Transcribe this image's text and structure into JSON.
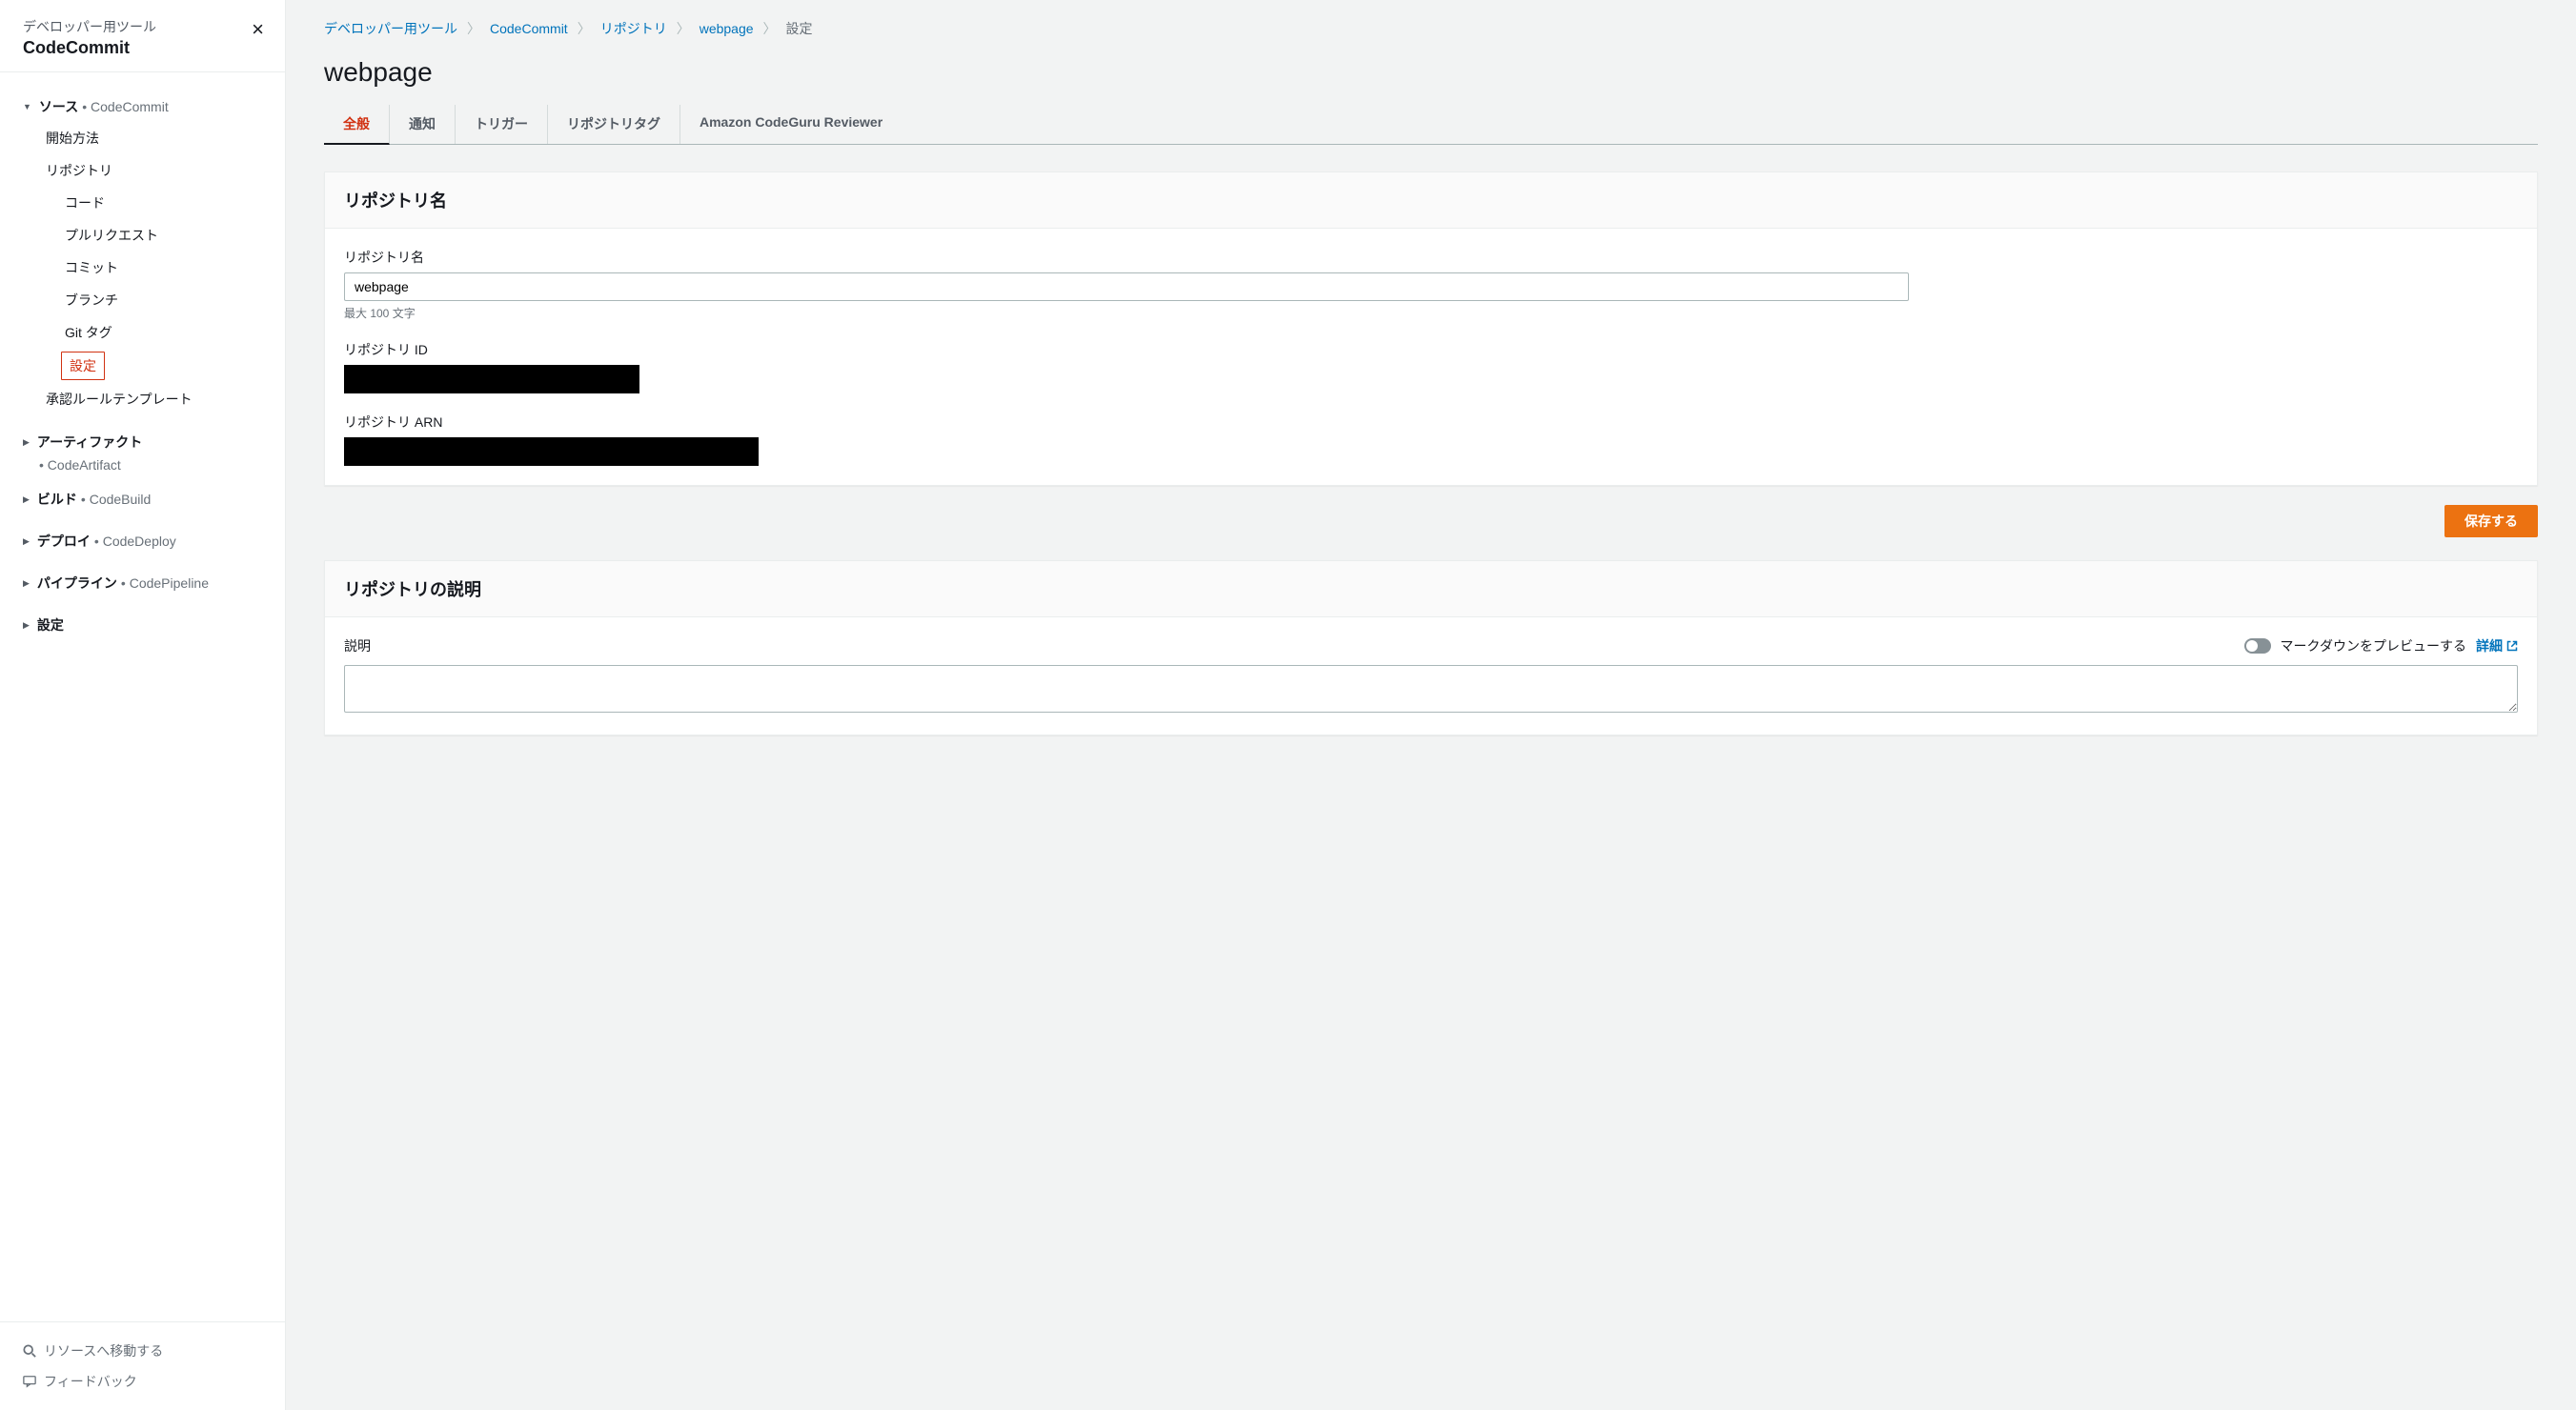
{
  "sidebar": {
    "subtitle": "デベロッパー用ツール",
    "title": "CodeCommit",
    "groups": [
      {
        "label": "ソース",
        "suffix": "• CodeCommit",
        "open": true,
        "items": [
          {
            "label": "開始方法"
          },
          {
            "label": "リポジトリ",
            "sub": [
              {
                "label": "コード"
              },
              {
                "label": "プルリクエスト"
              },
              {
                "label": "コミット"
              },
              {
                "label": "ブランチ"
              },
              {
                "label": "Git タグ"
              },
              {
                "label": "設定",
                "active": true
              }
            ]
          },
          {
            "label": "承認ルールテンプレート"
          }
        ]
      },
      {
        "label": "アーティファクト",
        "suffix_below": "• CodeArtifact",
        "open": false
      },
      {
        "label": "ビルド",
        "suffix": "• CodeBuild",
        "open": false
      },
      {
        "label": "デプロイ",
        "suffix": "• CodeDeploy",
        "open": false
      },
      {
        "label": "パイプライン",
        "suffix": "• CodePipeline",
        "open": false
      },
      {
        "label": "設定",
        "open": false
      }
    ],
    "footer": {
      "search": "リソースへ移動する",
      "feedback": "フィードバック"
    }
  },
  "breadcrumb": {
    "items": [
      "デベロッパー用ツール",
      "CodeCommit",
      "リポジトリ",
      "webpage"
    ],
    "current": "設定"
  },
  "page": {
    "title": "webpage"
  },
  "tabs": [
    "全般",
    "通知",
    "トリガー",
    "リポジトリタグ",
    "Amazon CodeGuru Reviewer"
  ],
  "panel1": {
    "title": "リポジトリ名",
    "name_label": "リポジトリ名",
    "name_value": "webpage",
    "name_hint": "最大 100 文字",
    "id_label": "リポジトリ ID",
    "arn_label": "リポジトリ ARN"
  },
  "actions": {
    "save": "保存する"
  },
  "panel2": {
    "title": "リポジトリの説明",
    "desc_label": "説明",
    "toggle_label": "マークダウンをプレビューする",
    "detail_link": "詳細"
  }
}
